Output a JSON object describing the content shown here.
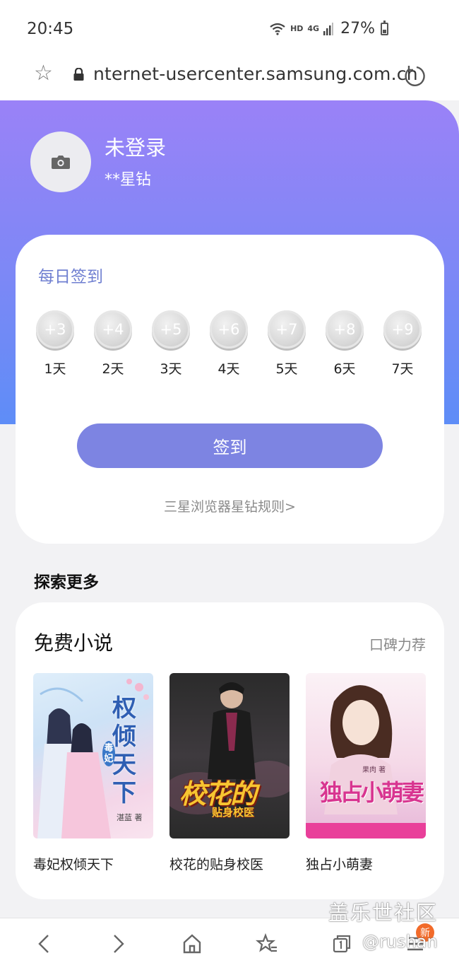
{
  "status_bar": {
    "time": "20:45",
    "network_hd": "HD",
    "network_4g": "4G",
    "battery": "27%"
  },
  "browser": {
    "url": "nternet-usercenter.samsung.com.cn"
  },
  "user": {
    "name": "未登录",
    "diamonds": "**星钻"
  },
  "checkin": {
    "title": "每日签到",
    "days": [
      {
        "points": "+3",
        "label": "1天"
      },
      {
        "points": "+4",
        "label": "2天"
      },
      {
        "points": "+5",
        "label": "3天"
      },
      {
        "points": "+6",
        "label": "4天"
      },
      {
        "points": "+7",
        "label": "5天"
      },
      {
        "points": "+8",
        "label": "6天"
      },
      {
        "points": "+9",
        "label": "7天"
      }
    ],
    "button": "签到",
    "rules_link": "三星浏览器星钻规则>"
  },
  "explore": {
    "title": "探索更多",
    "novels": {
      "title": "免费小说",
      "more": "口碑力荐",
      "books": [
        {
          "title": "毒妃权倾天下",
          "cover_text": "权倾天下",
          "cover_tag": "毒妃",
          "cover_author": "湛蓝 著"
        },
        {
          "title": "校花的贴身校医",
          "cover_text": "校花的",
          "cover_sub": "贴身校医"
        },
        {
          "title": "独占小萌妻",
          "cover_text": "独占小萌妻",
          "cover_author": "果肉 著"
        }
      ]
    }
  },
  "bottom_nav": {
    "new_badge": "新"
  },
  "watermark": {
    "line1": "盖乐世社区",
    "line2": "@rushan"
  }
}
